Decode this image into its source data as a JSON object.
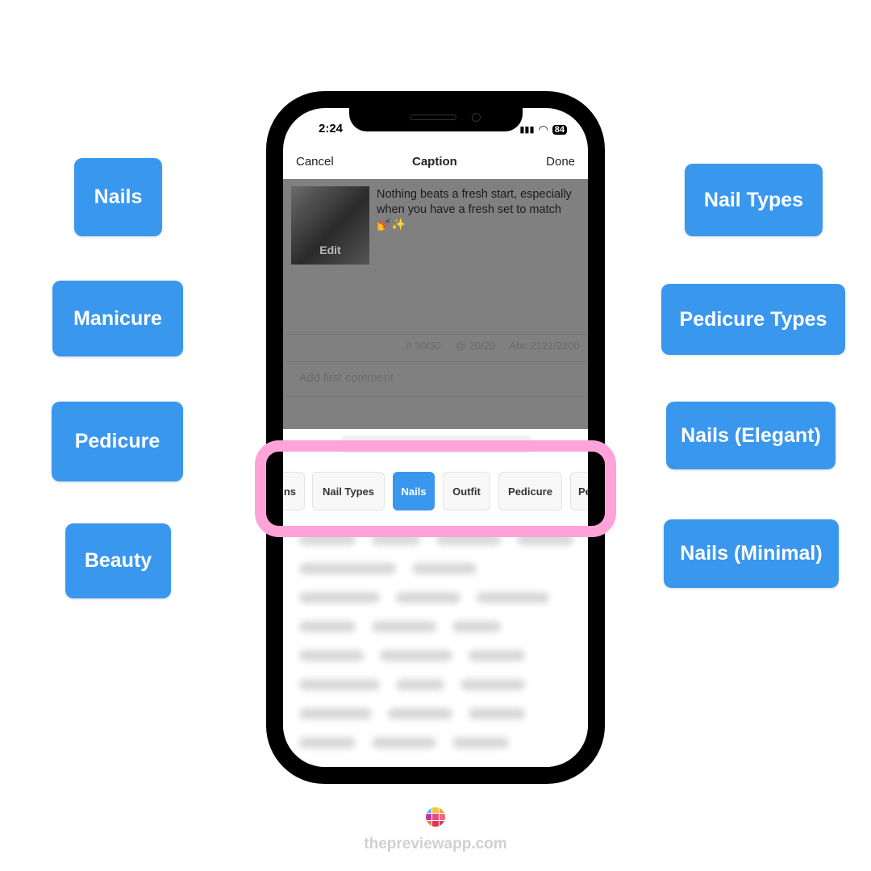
{
  "left_tags": [
    "Nails",
    "Manicure",
    "Pedicure",
    "Beauty"
  ],
  "right_tags": [
    "Nail Types",
    "Pedicure Types",
    "Nails (Elegant)",
    "Nails (Minimal)"
  ],
  "phone": {
    "time": "2:24",
    "battery": "84",
    "nav": {
      "cancel": "Cancel",
      "title": "Caption",
      "done": "Done"
    },
    "thumb_edit": "Edit",
    "caption": "Nothing beats a fresh start, especially when you have a fresh set to match 💅✨",
    "counts": {
      "hashtags": "# 30/30",
      "mentions": "@ 20/20",
      "chars": "Abc 2121/2200"
    },
    "comment_placeholder": "Add first comment",
    "chips": [
      {
        "label": "ns",
        "active": false
      },
      {
        "label": "Nail Types",
        "active": false
      },
      {
        "label": "Nails",
        "active": true
      },
      {
        "label": "Outfit",
        "active": false
      },
      {
        "label": "Pedicure",
        "active": false
      },
      {
        "label": "Pe",
        "active": false
      }
    ]
  },
  "footer": {
    "site": "thepreviewapp.com"
  },
  "colors": {
    "accent": "#3a97ee",
    "highlight": "#ffa3d9"
  }
}
